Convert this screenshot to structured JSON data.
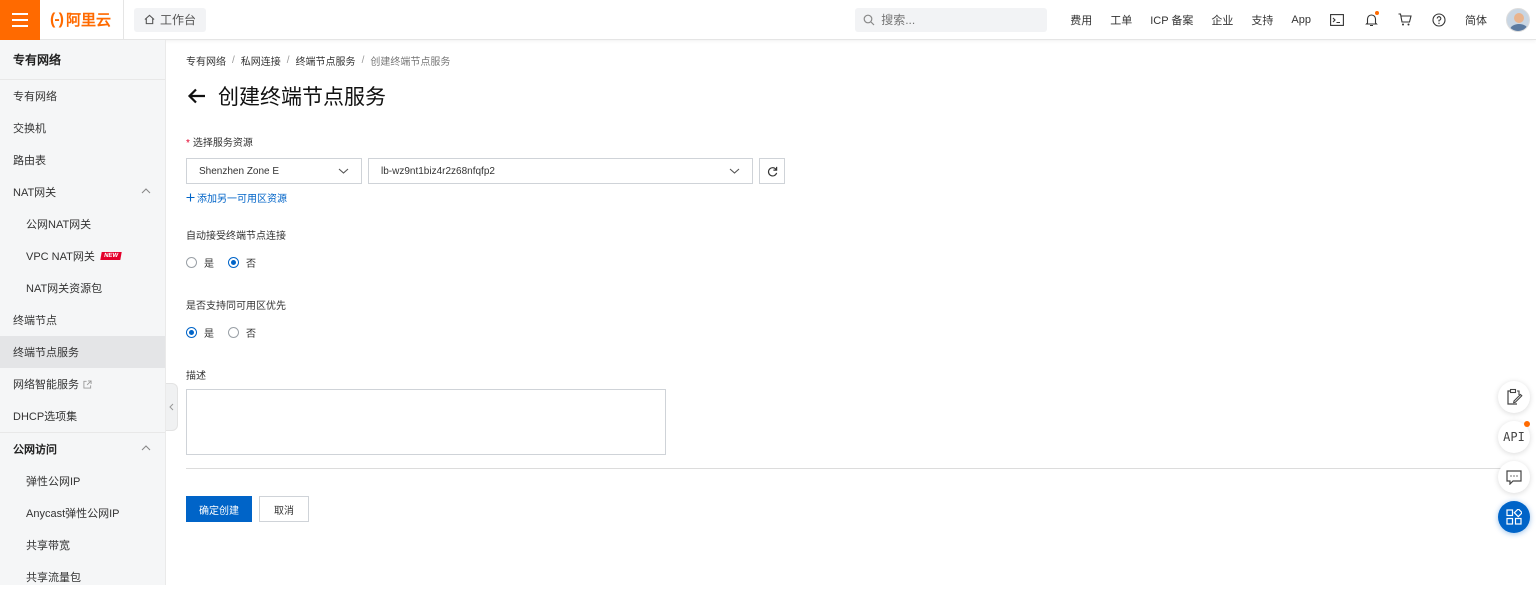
{
  "topbar": {
    "logo_mark": "(-)",
    "logo_text": "阿里云",
    "workbench": "工作台",
    "search_placeholder": "搜索...",
    "links": [
      "费用",
      "工单",
      "ICP 备案",
      "企业",
      "支持",
      "App"
    ],
    "lang": "简体"
  },
  "sidebar": {
    "title": "专有网络",
    "items": [
      {
        "label": "专有网络"
      },
      {
        "label": "交换机"
      },
      {
        "label": "路由表"
      },
      {
        "label": "NAT网关"
      },
      {
        "label": "公网NAT网关"
      },
      {
        "label": "VPC NAT网关",
        "badge": "NEW"
      },
      {
        "label": "NAT网关资源包"
      },
      {
        "label": "终端节点"
      },
      {
        "label": "终端节点服务"
      },
      {
        "label": "网络智能服务"
      },
      {
        "label": "DHCP选项集"
      },
      {
        "label": "公网访问"
      },
      {
        "label": "弹性公网IP"
      },
      {
        "label": "Anycast弹性公网IP"
      },
      {
        "label": "共享带宽"
      },
      {
        "label": "共享流量包"
      }
    ]
  },
  "breadcrumb": [
    "专有网络",
    "私网连接",
    "终端节点服务",
    "创建终端节点服务"
  ],
  "page_title": "创建终端节点服务",
  "form": {
    "resource_label": "选择服务资源",
    "zone_value": "Shenzhen Zone E",
    "resource_value": "lb-wz9nt1biz4r2z68nfqfp2",
    "add_zone_link": "添加另一可用区资源",
    "auto_accept_label": "自动接受终端节点连接",
    "auto_accept_options": [
      "是",
      "否"
    ],
    "auto_accept_selected": "否",
    "zone_affinity_label": "是否支持同可用区优先",
    "zone_affinity_options": [
      "是",
      "否"
    ],
    "zone_affinity_selected": "是",
    "description_label": "描述",
    "submit_label": "确定创建",
    "cancel_label": "取消"
  },
  "float_tools": {
    "api_label": "API"
  },
  "colors": {
    "brand": "#ff6a00",
    "primary": "#0064c8",
    "required": "#e4002b"
  }
}
